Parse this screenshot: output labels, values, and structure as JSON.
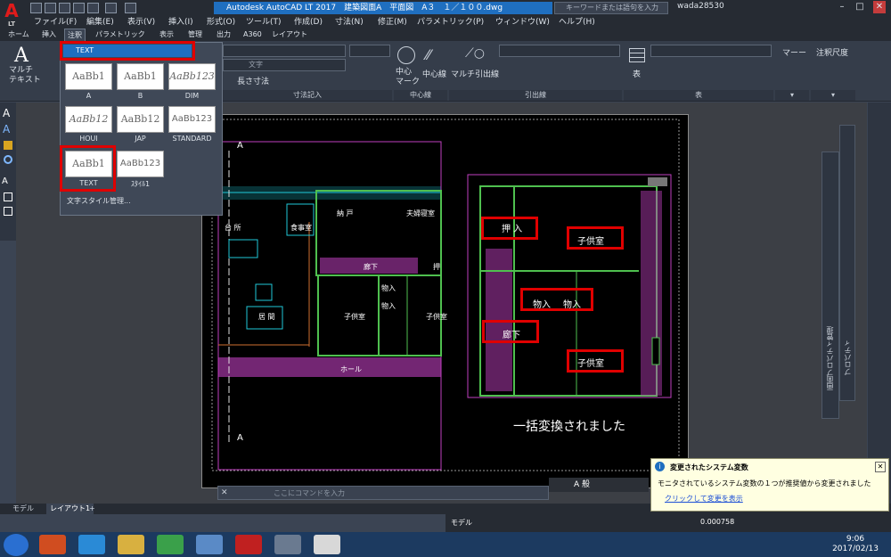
{
  "app": {
    "logo": "A",
    "logo_sub": "LT",
    "title": "Autodesk AutoCAD LT 2017　建築図面A　平面図　A３　１／１００.dwg",
    "search_placeholder": "キーワードまたは語句を入力",
    "user": "wada28530"
  },
  "menubar": [
    "ファイル(F)",
    "編集(E)",
    "表示(V)",
    "挿入(I)",
    "形式(O)",
    "ツール(T)",
    "作成(D)",
    "寸法(N)",
    "修正(M)",
    "パラメトリック(P)",
    "ウィンドウ(W)",
    "ヘルプ(H)"
  ],
  "ribbon_tabs": [
    "ホーム",
    "挿入",
    "注釈",
    "パラメトリック",
    "表示",
    "管理",
    "出力",
    "A360",
    "レイアウト"
  ],
  "ribbon": {
    "multitext": "マルチ\nテキスト",
    "current_text_style": "TEXT",
    "layer_text": "文字",
    "dim_label": "長さ寸法",
    "dim_panel": "寸法記入",
    "center_mark": "中心\nマーク",
    "center_line": "中心線",
    "centerline_panel": "中心線",
    "mleader": "マルチ引出線",
    "leader_panel": "引出線",
    "table": "表",
    "table_panel": "表",
    "markup": "マーー",
    "annoscale": "注釈尺度"
  },
  "text_styles": [
    {
      "preview": "AaBb1",
      "name": "A"
    },
    {
      "preview": "AaBb1",
      "name": "B"
    },
    {
      "preview": "AaBb123",
      "name": "DIM"
    },
    {
      "preview": "AaBb12",
      "name": "HOUI"
    },
    {
      "preview": "AaBb12",
      "name": "JAP"
    },
    {
      "preview": "AaBb123",
      "name": "STANDARD"
    },
    {
      "preview": "AaBb1",
      "name": "TEXT"
    },
    {
      "preview": "AaBb123",
      "name": "ｽﾀｲﾙ1"
    }
  ],
  "manage_text_styles": "文字スタイル管理...",
  "floorplan": {
    "left_labels": [
      "台 所",
      "食事室",
      "納 戸",
      "夫婦寝室",
      "廊下",
      "押",
      "物入",
      "物入",
      "子供室",
      "子供室",
      "居 間",
      "ホール"
    ],
    "right_labels": [
      "押 入",
      "子供室",
      "物入",
      "物入",
      "廊下",
      "子供室"
    ],
    "section_marks": [
      "A",
      "A"
    ]
  },
  "converted_message": "一括変換されました",
  "command_placeholder": "ここにコマンドを入力",
  "layout_tabs": [
    "モデル",
    "レイアウト1"
  ],
  "status": {
    "mode": "モデル",
    "scale": "0.000758"
  },
  "props_palette": "プロパティ",
  "props_palette2": "画面プロパティ管理",
  "ime": "A 般",
  "notification": {
    "title": "変更されたシステム変数",
    "body": "モニタされているシステム変数の１つが推奨値から変更されました",
    "link": "クリックして変更を表示"
  },
  "clock": {
    "time": "9:06",
    "date": "2017/02/13"
  },
  "colors": {
    "accent": "#1f6fc0",
    "highlight": "#e00000",
    "walls": "#4fc04f",
    "cyan": "#20c8d8",
    "magenta": "#c040c0"
  }
}
